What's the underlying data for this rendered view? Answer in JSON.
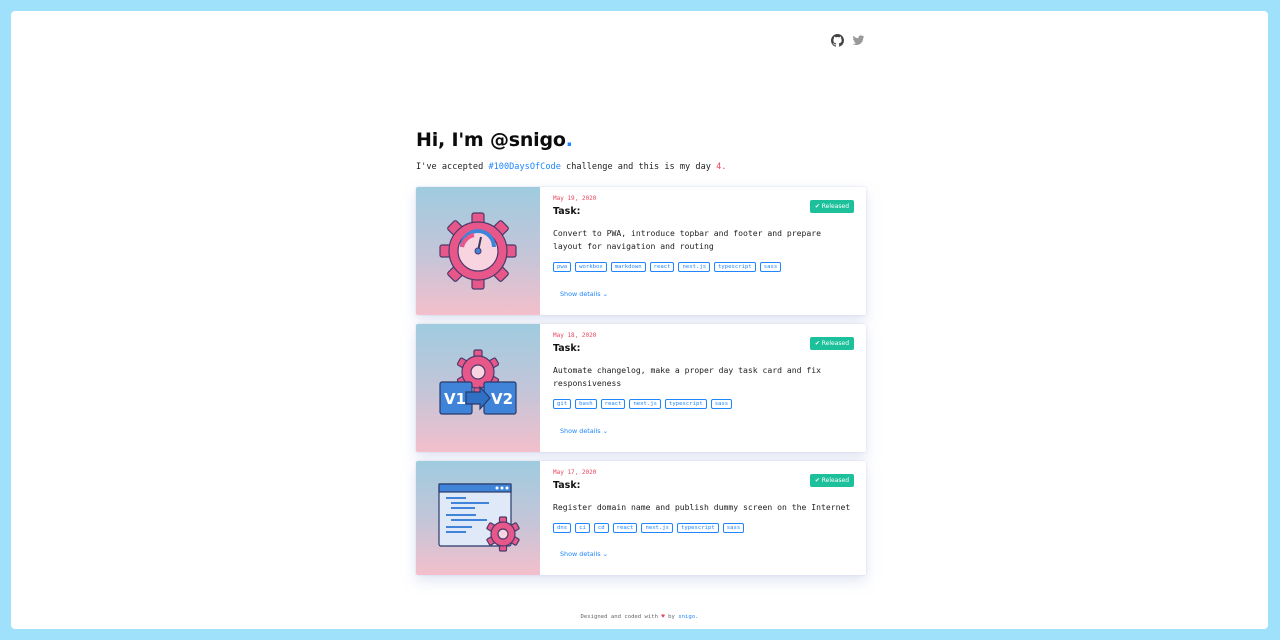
{
  "header": {
    "greeting_prefix": "Hi, I'm @snigo",
    "greeting_dot": ".",
    "social": [
      "github-icon",
      "twitter-icon"
    ]
  },
  "intro": {
    "before": "I've accepted ",
    "hashtag": "#100DaysOfCode",
    "middle": " challenge and this is my day ",
    "day": "4",
    "after": "."
  },
  "cards": [
    {
      "date": "May 19, 2020",
      "title": "Task:",
      "badge": "✔ Released",
      "description": "Convert to PWA, introduce topbar and footer and prepare layout for navigation and routing",
      "tags": [
        "pwa",
        "workbox",
        "markdown",
        "react",
        "next.js",
        "typescript",
        "sass"
      ],
      "details": "Show details ⌄",
      "image": "settings-gauge-icon"
    },
    {
      "date": "May 18, 2020",
      "title": "Task:",
      "badge": "✔ Released",
      "description": "Automate changelog, make a proper day task card and fix responsiveness",
      "tags": [
        "git",
        "bash",
        "react",
        "next.js",
        "typescript",
        "sass"
      ],
      "details": "Show details ⌄",
      "image": "version-upgrade-icon",
      "image_text": [
        "V1",
        "V2"
      ]
    },
    {
      "date": "May 17, 2020",
      "title": "Task:",
      "badge": "✔ Released",
      "description": "Register domain name and publish dummy screen on the Internet",
      "tags": [
        "dns",
        "ci",
        "cd",
        "react",
        "next.js",
        "typescript",
        "sass"
      ],
      "details": "Show details ⌄",
      "image": "browser-settings-icon"
    }
  ],
  "footer": {
    "text": "Designed and coded with ",
    "heart": "♥",
    "by": " by ",
    "author": "snigo",
    "end": "."
  },
  "colors": {
    "accent": "#1f86ff",
    "highlight": "#e8455d",
    "released": "#1cc09a",
    "background": "#9fe0fb"
  }
}
